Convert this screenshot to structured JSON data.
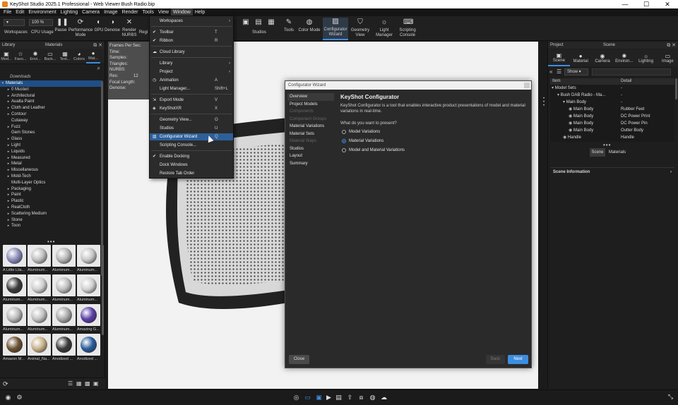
{
  "app": {
    "title": "KeyShot Studio 2025.1 Professional - Web Viewer Bush Radio.bip",
    "win_min": "—",
    "win_max": "☐",
    "win_close": "✕"
  },
  "menubar": [
    "File",
    "Edit",
    "Environment",
    "Lighting",
    "Camera",
    "Image",
    "Render",
    "Tools",
    "View",
    "Window",
    "Help"
  ],
  "ribbon": {
    "zoom_value": "100 %",
    "items": {
      "workspaces": "Workspaces",
      "cpu_usage": "CPU Usage",
      "pause": "Pause",
      "performance_mode": "Performance Mode",
      "gpu": "GPU",
      "denoise": "Denoise",
      "render_nurbs": "Render NURBS",
      "region": "Regi",
      "studios": "Studios",
      "tools": "Tools",
      "color_mode": "Color Mode",
      "configurator_wizard": "Configurator Wizard",
      "geometry_view": "Geometry View",
      "light_manager": "Light Manager",
      "scripting_console": "Scripting Console"
    }
  },
  "window_menu": {
    "items": [
      {
        "label": "Workspaces",
        "shortcut": "",
        "submenu": true
      },
      {
        "label": "Toolbar",
        "shortcut": "T",
        "checked": true
      },
      {
        "label": "Ribbon",
        "shortcut": "R",
        "checked": true
      },
      {
        "label": "Cloud Library",
        "shortcut": ""
      },
      {
        "label": "Library",
        "shortcut": "",
        "submenu": true
      },
      {
        "label": "Project",
        "shortcut": "",
        "submenu": true
      },
      {
        "label": "Animation",
        "shortcut": "A"
      },
      {
        "label": "Light Manager...",
        "shortcut": "Shift+L"
      },
      {
        "label": "Export Mode",
        "shortcut": "V"
      },
      {
        "label": "KeyShotXR",
        "shortcut": "X"
      },
      {
        "label": "Geometry View...",
        "shortcut": "O"
      },
      {
        "label": "Studios",
        "shortcut": "U"
      },
      {
        "label": "Configurator Wizard",
        "shortcut": "Q"
      },
      {
        "label": "Scripting Console...",
        "shortcut": ""
      },
      {
        "label": "Enable Docking",
        "shortcut": "",
        "checked": true
      },
      {
        "label": "Dock Windows",
        "shortcut": ""
      },
      {
        "label": "Restore Tab Order",
        "shortcut": ""
      }
    ]
  },
  "library": {
    "header": "Library",
    "sub_header": "Materials",
    "tabs": [
      "Mod...",
      "Favo...",
      "Envi...",
      "Back...",
      "Text...",
      "Colors",
      "Mat..."
    ],
    "section": "Downloads",
    "selected_root": "Materials",
    "tree": [
      "0 Musteri",
      "Architectural",
      "Aualta Paint",
      "Cloth and Leather",
      "Contour",
      "Cutaway",
      "Fuzz",
      "Gem Stones",
      "Glass",
      "Light",
      "Liquids",
      "Measured",
      "Metal",
      "Miscellaneous",
      "Mold-Tech",
      "Multi-Layer Optics",
      "Packaging",
      "Paint",
      "Plastic",
      "RealCloth",
      "Scattering Medium",
      "Stone",
      "Toon"
    ],
    "expandable": [
      true,
      true,
      true,
      true,
      true,
      false,
      true,
      false,
      true,
      true,
      true,
      true,
      true,
      true,
      true,
      false,
      true,
      true,
      true,
      true,
      true,
      true,
      true
    ],
    "thumbnails": [
      {
        "label": "A Little Lila...",
        "color": "#8a8ab8"
      },
      {
        "label": "Aluminum...",
        "color": "#bfbfbf"
      },
      {
        "label": "Aluminum...",
        "color": "#b5b5b5"
      },
      {
        "label": "Aluminum...",
        "color": "#c7c7c7"
      },
      {
        "label": "Aluminum...",
        "color": "#3a3a3a"
      },
      {
        "label": "Aluminum...",
        "color": "#cfcfcf"
      },
      {
        "label": "Aluminum...",
        "color": "#bdbdbd"
      },
      {
        "label": "Aluminum...",
        "color": "#d0d0d0"
      },
      {
        "label": "Aluminum...",
        "color": "#b8b8b8"
      },
      {
        "label": "Aluminum...",
        "color": "#c2c2c2"
      },
      {
        "label": "Aluminum...",
        "color": "#a8a8a8"
      },
      {
        "label": "Amazing G...",
        "color": "#5c3fa8"
      },
      {
        "label": "Amazon M...",
        "color": "#6b5230"
      },
      {
        "label": "Animal_Na...",
        "color": "#c9b38a"
      },
      {
        "label": "Anodized ...",
        "color": "#3a3a3a"
      },
      {
        "label": "Anodized ...",
        "color": "#2a5c9a"
      }
    ]
  },
  "viewport_stats": [
    "Frames Per Sec:",
    "Time:",
    "Samples:",
    "Triangles:",
    "NURBS:",
    "Res:",
    "Focal Length:",
    "Denoise:"
  ],
  "viewport_res_value": "12",
  "project": {
    "header": "Project",
    "sub_header": "Scene",
    "tabs": [
      "Scene",
      "Material",
      "Camera",
      "Environ...",
      "Lighting",
      "Image"
    ],
    "filter_value": "Show",
    "columns": [
      "Item",
      "Detail"
    ],
    "rows": [
      {
        "item": "Model Sets",
        "detail": "-"
      },
      {
        "item": "Bush DAB Radio - Ma...",
        "detail": "-"
      },
      {
        "item": "Main Body",
        "detail": "-"
      },
      {
        "item": "Main Body",
        "detail": "Rubber Feet"
      },
      {
        "item": "Main Body",
        "detail": "DC Power Print"
      },
      {
        "item": "Main Body",
        "detail": "DC Power Pin"
      },
      {
        "item": "Main Body",
        "detail": "Outter Body"
      },
      {
        "item": "Handle",
        "detail": "Handle"
      }
    ],
    "sub_tabs": [
      "Scene",
      "Materials"
    ],
    "scene_info": "Scene Information"
  },
  "wizard": {
    "title": "Configurator Wizard",
    "nav": [
      {
        "label": "Overview",
        "state": "active"
      },
      {
        "label": "Project Models",
        "state": "normal"
      },
      {
        "label": "Components",
        "state": "dim"
      },
      {
        "label": "Component Groups",
        "state": "dim"
      },
      {
        "label": "Material Variations",
        "state": "normal"
      },
      {
        "label": "Material Sets",
        "state": "normal"
      },
      {
        "label": "Material Ways",
        "state": "dim"
      },
      {
        "label": "Studios",
        "state": "normal"
      },
      {
        "label": "Layout",
        "state": "normal"
      },
      {
        "label": "Summary",
        "state": "normal"
      }
    ],
    "heading": "KeyShot Configurator",
    "description": "KeyShot Configurator is a tool that enables interactive product presentations of model and material variations in real-time.",
    "question": "What do you want to present?",
    "options": [
      "Model Variations",
      "Material Variations",
      "Model and Material Variations"
    ],
    "selected_option": 1,
    "close_label": "Close",
    "back_label": "Back",
    "next_label": "Next"
  },
  "colors": {
    "accent": "#3d8de0",
    "selection": "#1f4f86",
    "menu_highlight": "#2d5f98",
    "panel_bg": "#1e1e1e"
  }
}
